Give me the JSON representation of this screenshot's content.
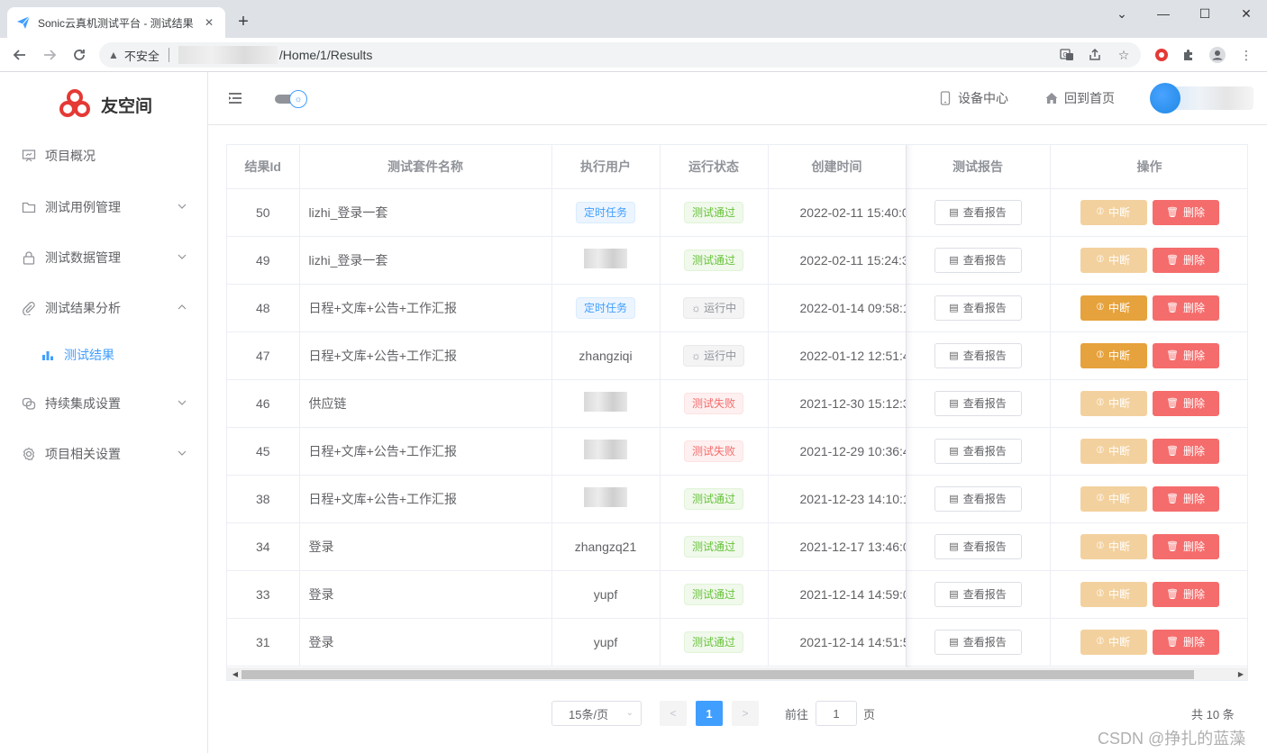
{
  "browser": {
    "tab_title": "Sonic云真机测试平台 - 测试结果",
    "security_label": "不安全",
    "url_path": "/Home/1/Results"
  },
  "app": {
    "logo_text": "友空间",
    "header": {
      "device_center": "设备中心",
      "back_home": "回到首页"
    },
    "sidebar": {
      "items": [
        {
          "label": "项目概况"
        },
        {
          "label": "测试用例管理"
        },
        {
          "label": "测试数据管理"
        },
        {
          "label": "测试结果分析"
        },
        {
          "label": "测试结果"
        },
        {
          "label": "持续集成设置"
        },
        {
          "label": "项目相关设置"
        }
      ]
    }
  },
  "table": {
    "columns": [
      "结果Id",
      "测试套件名称",
      "执行用户",
      "运行状态",
      "创建时间",
      "测试报告",
      "操作"
    ],
    "report_label": "查看报告",
    "stop_label": "中断",
    "delete_label": "删除",
    "rows": [
      {
        "id": "50",
        "suite": "lizhi_登录一套",
        "user": "定时任务",
        "user_kind": "tag",
        "status": "测试通过",
        "status_kind": "green",
        "time": "2022-02-11 15:40:0",
        "stoppable": false
      },
      {
        "id": "49",
        "suite": "lizhi_登录一套",
        "user": "",
        "user_kind": "blur",
        "status": "测试通过",
        "status_kind": "green",
        "time": "2022-02-11 15:24:3",
        "stoppable": false
      },
      {
        "id": "48",
        "suite": "日程+文库+公告+工作汇报",
        "user": "定时任务",
        "user_kind": "tag",
        "status": "运行中",
        "status_kind": "gray",
        "time": "2022-01-14 09:58:1",
        "stoppable": true
      },
      {
        "id": "47",
        "suite": "日程+文库+公告+工作汇报",
        "user": "zhangziqi",
        "user_kind": "text",
        "status": "运行中",
        "status_kind": "gray",
        "time": "2022-01-12 12:51:4",
        "stoppable": true
      },
      {
        "id": "46",
        "suite": "供应链",
        "user": "",
        "user_kind": "blur",
        "status": "测试失败",
        "status_kind": "red",
        "time": "2021-12-30 15:12:3",
        "stoppable": false
      },
      {
        "id": "45",
        "suite": "日程+文库+公告+工作汇报",
        "user": "",
        "user_kind": "blur",
        "status": "测试失败",
        "status_kind": "red",
        "time": "2021-12-29 10:36:4",
        "stoppable": false
      },
      {
        "id": "38",
        "suite": "日程+文库+公告+工作汇报",
        "user": "",
        "user_kind": "blur",
        "status": "测试通过",
        "status_kind": "green",
        "time": "2021-12-23 14:10:1",
        "stoppable": false
      },
      {
        "id": "34",
        "suite": "登录",
        "user": "zhangzq21",
        "user_kind": "text",
        "status": "测试通过",
        "status_kind": "green",
        "time": "2021-12-17 13:46:0",
        "stoppable": false
      },
      {
        "id": "33",
        "suite": "登录",
        "user": "yupf",
        "user_kind": "text",
        "status": "测试通过",
        "status_kind": "green",
        "time": "2021-12-14 14:59:0",
        "stoppable": false
      },
      {
        "id": "31",
        "suite": "登录",
        "user": "yupf",
        "user_kind": "text",
        "status": "测试通过",
        "status_kind": "green",
        "time": "2021-12-14 14:51:5",
        "stoppable": false
      }
    ]
  },
  "pagination": {
    "page_size": "15条/页",
    "current_page": "1",
    "goto_label": "前往",
    "goto_value": "1",
    "page_unit": "页",
    "total": "共 10 条"
  },
  "watermark": "CSDN @挣扎的蓝藻",
  "colors": {
    "primary": "#409eff",
    "warning": "#e6a23c",
    "danger": "#f56c6c",
    "success": "#67c23a"
  }
}
